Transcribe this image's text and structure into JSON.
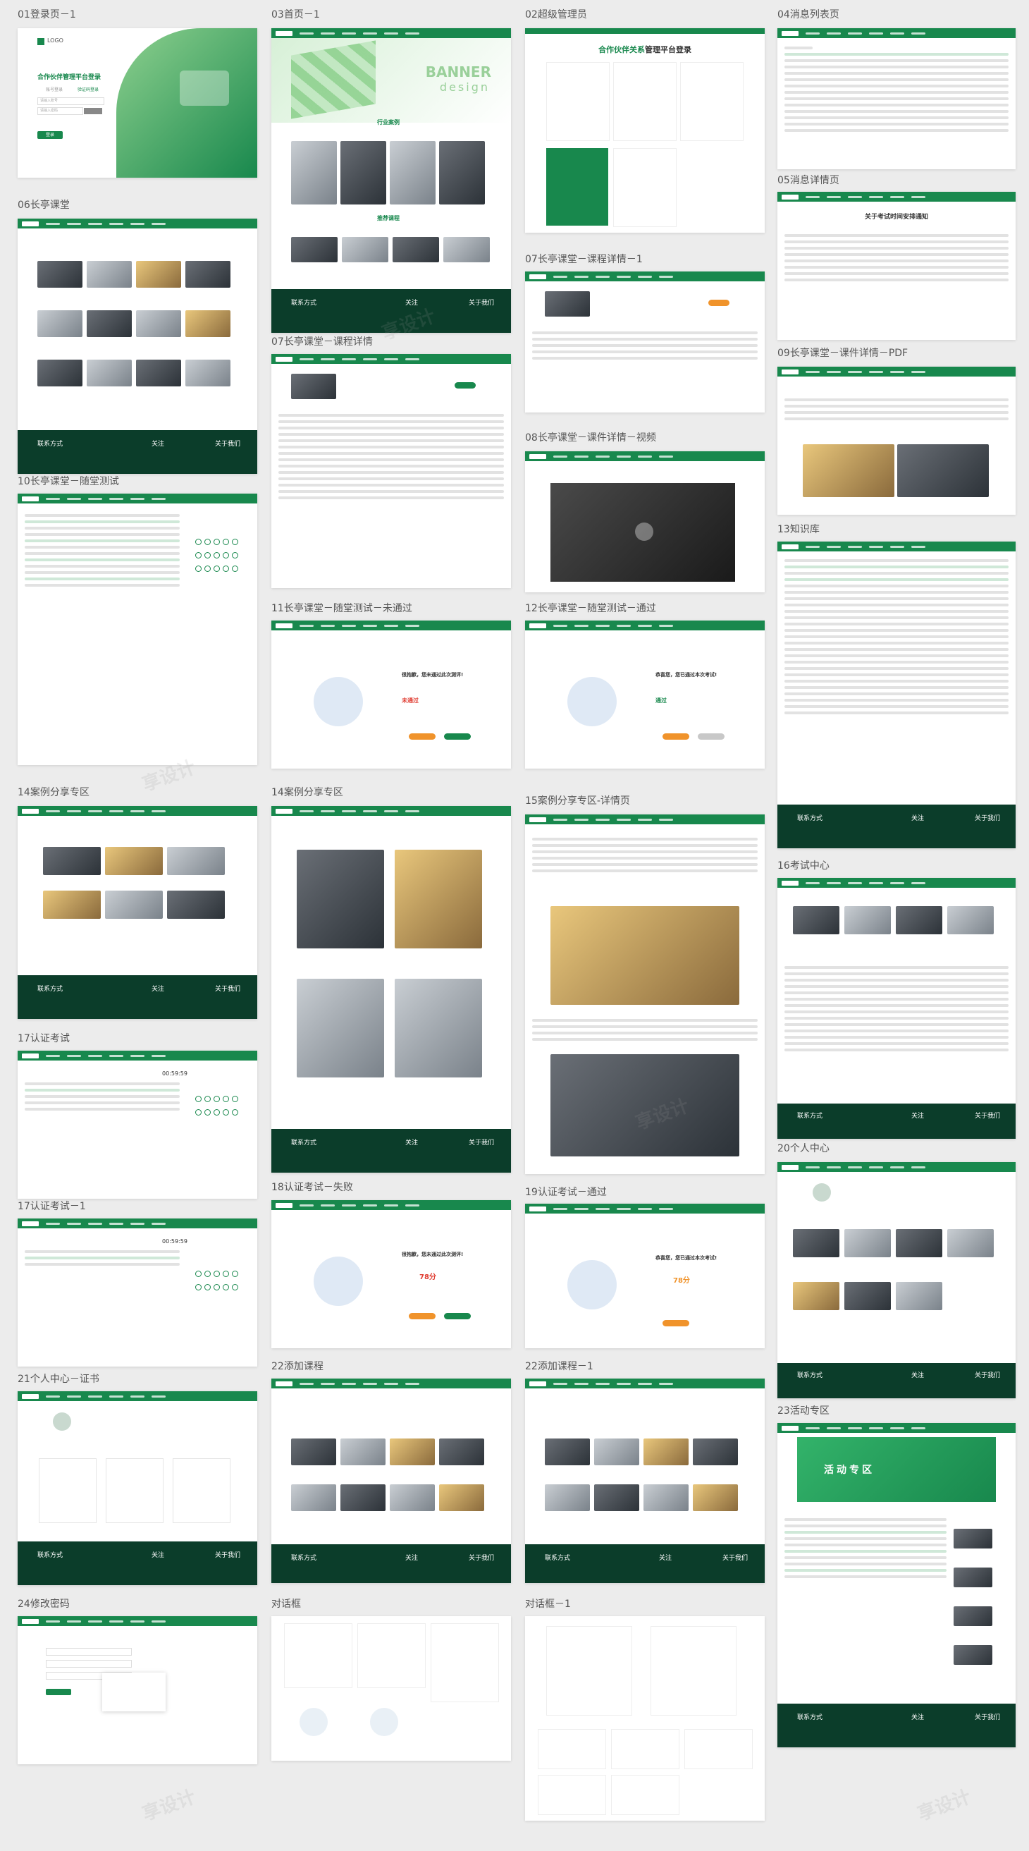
{
  "captions": [
    "01登录页－1",
    "03首页－1",
    "02超级管理员",
    "04消息列表页",
    "05消息详情页",
    "06长亭课堂",
    "07长亭课堂－课程详情－1",
    "07长亭课堂－课程详情",
    "08长亭课堂－课件详情－视频",
    "09长亭课堂－课件详情－PDF",
    "10长亭课堂－随堂测试",
    "11长亭课堂－随堂测试－未通过",
    "12长亭课堂－随堂测试－通过",
    "13知识库",
    "14案例分享专区",
    "14案例分享专区",
    "15案例分享专区-详情页",
    "16考试中心",
    "17认证考试",
    "18认证考试－失败",
    "19认证考试－通过",
    "17认证考试－1",
    "20个人中心",
    "21个人中心－证书",
    "22添加课程",
    "22添加课程－1",
    "23活动专区",
    "24修改密码",
    "对话框",
    "对话框－1"
  ],
  "login": {
    "logo": "LOGO",
    "title": "合作伙伴管理平台登录",
    "tab_account": "账号登录",
    "tab_phone": "验证码登录",
    "field_user": "请输入账号",
    "field_pass": "请输入密码",
    "submit": "登录"
  },
  "home": {
    "banner_line1": "BANNER",
    "banner_line2": "design",
    "section_industry": "行业案例",
    "section_recommend": "推荐课程"
  },
  "admin": {
    "title_green": "合作伙伴关系",
    "title_dark": "管理平台登录"
  },
  "notice_detail": {
    "title": "关于考试时间安排通知"
  },
  "exam_fail": {
    "headline": "很抱歉，您未通过此次测评!",
    "status_label": "未通过",
    "score": "78分",
    "retry": "再测一次",
    "back": "返回首页"
  },
  "exam_pass": {
    "headline": "恭喜您，您已通过本次考试!",
    "status_label": "通过",
    "score": "78分"
  },
  "timer": "00:59:59",
  "activity": {
    "banner": "活动专区"
  },
  "footer": {
    "contact": "联系方式",
    "about": "关于我们",
    "follow": "关注"
  },
  "watermark": "享设计",
  "colors": {
    "brand": "#18884d",
    "dark": "#0b3d2a",
    "accent": "#f0932b",
    "fail": "#e03c31"
  }
}
